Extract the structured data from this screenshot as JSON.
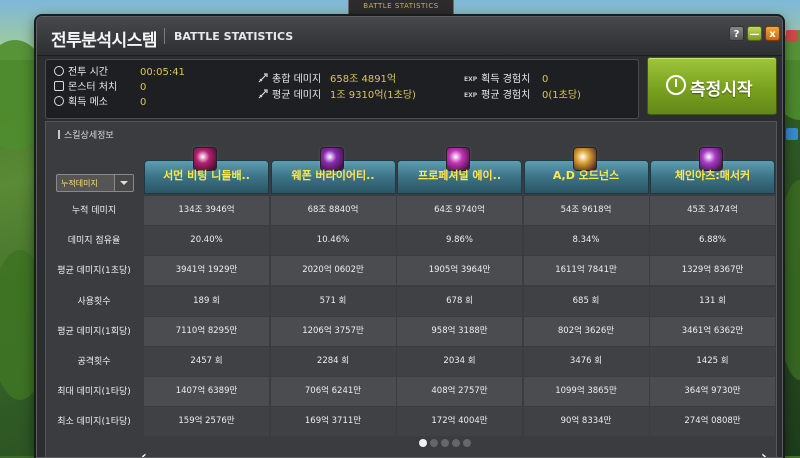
{
  "backdrop": {
    "top_label": "BATTLE STATISTICS"
  },
  "window": {
    "title": "전투분석시스템",
    "subtitle": "BATTLE STATISTICS",
    "controls": {
      "help": "?",
      "minimize": "—",
      "close": "x"
    }
  },
  "summary": {
    "left": [
      {
        "label": "전투 시간",
        "value": "00:05:41",
        "icon": "clock-icon"
      },
      {
        "label": "몬스터 처치",
        "value": "0",
        "icon": "monster-icon"
      },
      {
        "label": "획득 메소",
        "value": "0",
        "icon": "meso-icon"
      }
    ],
    "middle": [
      {
        "label": "총합 데미지",
        "value": "658조 4891억",
        "icon": "sword-icon"
      },
      {
        "label": "평균 데미지",
        "value": "1조 9310억(1초당)",
        "icon": "sword-icon"
      }
    ],
    "right": [
      {
        "prefix": "EXP",
        "label": "획득 경험치",
        "value": "0"
      },
      {
        "prefix": "EXP",
        "label": "평균 경험치",
        "value": "0(1초당)"
      }
    ],
    "measure_button": "측정시작"
  },
  "panel": {
    "heading": "스킬상세정보",
    "sort_dropdown": {
      "selected": "누적데미지"
    },
    "row_labels": [
      "누적 데미지",
      "데미지 점유율",
      "평균 데미지(1초당)",
      "사용횟수",
      "평균 데미지(1회당)",
      "공격횟수",
      "최대 데미지(1타당)",
      "최소 데미지(1타당)"
    ],
    "skills": [
      {
        "name": "서먼 비팅 니들배..",
        "icon_color": "#b5206f",
        "values": [
          "134조 3946억",
          "20.40%",
          "3941억 1929만",
          "189 회",
          "7110억 8295만",
          "2457 회",
          "1407억 6389만",
          "159억 2576만"
        ]
      },
      {
        "name": "웨폰 버라이어티..",
        "icon_color": "#8a2ab0",
        "values": [
          "68조 8840억",
          "10.46%",
          "2020억 0602만",
          "571 회",
          "1206억 3757만",
          "2284 회",
          "706억 6241만",
          "169억 3711만"
        ]
      },
      {
        "name": "프로페셔널 에이..",
        "icon_color": "#c434b8",
        "values": [
          "64조 9740억",
          "9.86%",
          "1905억 3964만",
          "678 회",
          "958억 3188만",
          "2034 회",
          "408억 2757만",
          "172억 4004만"
        ]
      },
      {
        "name": "A,D 오드넌스",
        "icon_color": "#d9a030",
        "values": [
          "54조 9618억",
          "8.34%",
          "1611억 7841만",
          "685 회",
          "802억 3626만",
          "3476 회",
          "1099억 3865만",
          "90억 8334만"
        ]
      },
      {
        "name": "체인아츠:매서커",
        "icon_color": "#a83cc6",
        "values": [
          "45조 3474억",
          "6.88%",
          "1329억 8367만",
          "131 회",
          "3461억 6362만",
          "1425 회",
          "364억 9730만",
          "274억 0808만"
        ]
      }
    ],
    "pager": {
      "pages": 5,
      "current": 1,
      "prev": "‹",
      "next": "›"
    }
  },
  "colors": {
    "accent_yellow": "#ffe84a",
    "measure_green": "#7aa11e",
    "header_teal": "#3c7386"
  }
}
